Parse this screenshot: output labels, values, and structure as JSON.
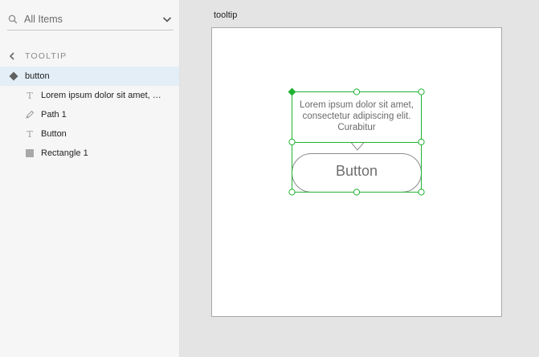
{
  "sidebar": {
    "filter": {
      "label": "All Items",
      "icon": "search-icon"
    },
    "breadcrumb": {
      "label": "TOOLTIP",
      "icon": "chevron-left-icon"
    },
    "layers": [
      {
        "label": "button",
        "icon": "group-diamond-icon",
        "selected": true
      },
      {
        "label": "Lorem ipsum dolor sit amet, consectetur adipiscing elit. Curabitur",
        "icon": "text-icon"
      },
      {
        "label": "Path 1",
        "icon": "pen-path-icon"
      },
      {
        "label": "Button",
        "icon": "text-icon"
      },
      {
        "label": "Rectangle 1",
        "icon": "rectangle-icon"
      }
    ]
  },
  "canvas": {
    "artboard_title": "tooltip",
    "tooltip_text": "Lorem ipsum dolor sit amet, consectetur adipiscing elit. Curabitur",
    "button_label": "Button",
    "selection_color": "#20b233",
    "shape_stroke_color": "#8a8a8a",
    "selected_row_color": "#e3eef7"
  }
}
